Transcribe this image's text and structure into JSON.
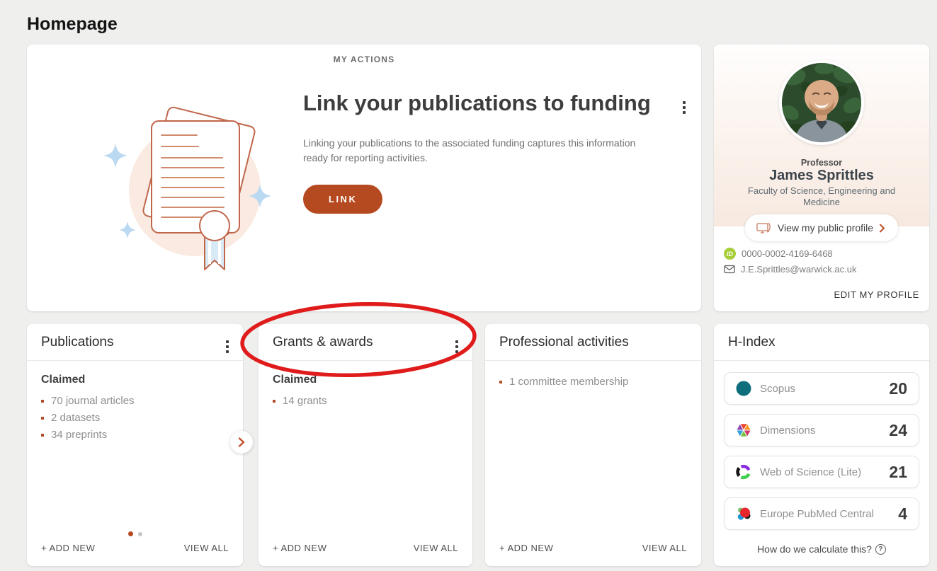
{
  "page": {
    "title": "Homepage"
  },
  "my_actions": {
    "label": "MY ACTIONS",
    "heading": "Link your publications to funding",
    "body": "Linking your publications to the associated funding captures this information ready for reporting activities.",
    "cta": "LINK",
    "illustration": "certificate-with-documents"
  },
  "profile": {
    "role": "Professor",
    "name": "James Sprittles",
    "faculty": "Faculty of Science, Engineering and Medicine",
    "view_profile_label": "View my public profile",
    "orcid": "0000-0002-4169-6468",
    "email": "J.E.Sprittles@warwick.ac.uk",
    "edit_label": "EDIT MY PROFILE"
  },
  "cards": {
    "publications": {
      "title": "Publications",
      "section": "Claimed",
      "items": [
        "70 journal articles",
        "2 datasets",
        "34 preprints"
      ],
      "add_new": "+ ADD NEW",
      "view_all": "VIEW ALL",
      "pages": 2,
      "active_page": 1
    },
    "grants": {
      "title": "Grants & awards",
      "section": "Claimed",
      "items": [
        "14 grants"
      ],
      "add_new": "+ ADD NEW",
      "view_all": "VIEW ALL"
    },
    "professional": {
      "title": "Professional activities",
      "items": [
        "1 committee membership"
      ],
      "add_new": "+ ADD NEW",
      "view_all": "VIEW ALL"
    },
    "h_index": {
      "title": "H-Index",
      "rows": [
        {
          "label": "Scopus",
          "value": "20",
          "icon": "scopus-icon"
        },
        {
          "label": "Dimensions",
          "value": "24",
          "icon": "dimensions-icon"
        },
        {
          "label": "Web of Science (Lite)",
          "value": "21",
          "icon": "web-of-science-icon"
        },
        {
          "label": "Europe PubMed Central",
          "value": "4",
          "icon": "europe-pmc-icon"
        }
      ],
      "footer": "How do we calculate this?"
    }
  },
  "annotation": {
    "shape": "ellipse",
    "color": "#e01b1b",
    "target": "grants-and-awards card header"
  },
  "colors": {
    "accent": "#b5491f",
    "background": "#efefee",
    "orcid_green": "#a6ce39",
    "scopus_teal": "#0e6e7c"
  }
}
